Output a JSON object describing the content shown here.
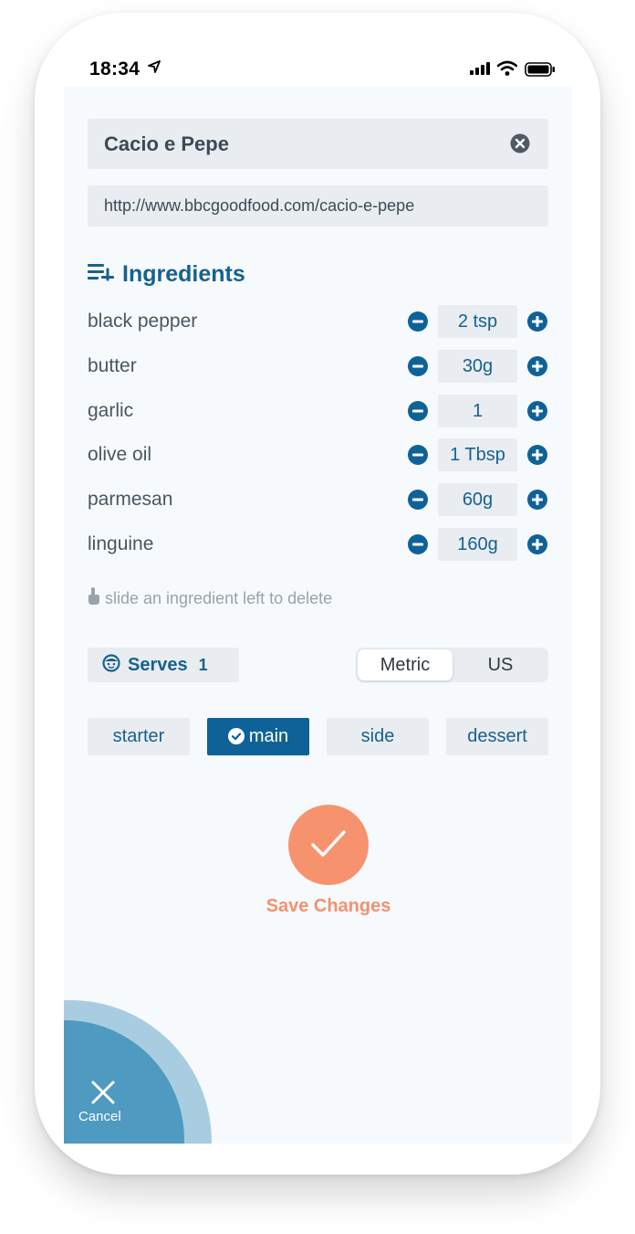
{
  "status_bar": {
    "time": "18:34"
  },
  "recipe": {
    "title": "Cacio e Pepe",
    "url": "http://www.bbcgoodfood.com/cacio-e-pepe"
  },
  "ingredients": {
    "heading": "Ingredients",
    "items": [
      {
        "name": "black pepper",
        "qty": "2 tsp"
      },
      {
        "name": "butter",
        "qty": "30g"
      },
      {
        "name": "garlic",
        "qty": "1"
      },
      {
        "name": "olive oil",
        "qty": "1 Tbsp"
      },
      {
        "name": "parmesan",
        "qty": "60g"
      },
      {
        "name": "linguine",
        "qty": "160g"
      }
    ],
    "hint": "slide an ingredient left to delete"
  },
  "serves": {
    "label": "Serves",
    "count": "1"
  },
  "units": {
    "options": [
      "Metric",
      "US"
    ],
    "selected": "Metric"
  },
  "courses": {
    "options": [
      "starter",
      "main",
      "side",
      "dessert"
    ],
    "selected": "main"
  },
  "save": {
    "label": "Save Changes"
  },
  "cancel": {
    "label": "Cancel"
  },
  "colors": {
    "primary": "#17618f",
    "accent": "#f7926f",
    "background": "#f6fafc",
    "chip": "#e9edf1",
    "cancel": "#4f9ac0"
  },
  "icons": [
    "location-arrow-icon",
    "signal-icon",
    "wifi-icon",
    "battery-icon",
    "clear-icon",
    "add-list-icon",
    "minus-icon",
    "plus-icon",
    "swipe-hand-icon",
    "face-icon",
    "check-icon",
    "close-icon"
  ]
}
